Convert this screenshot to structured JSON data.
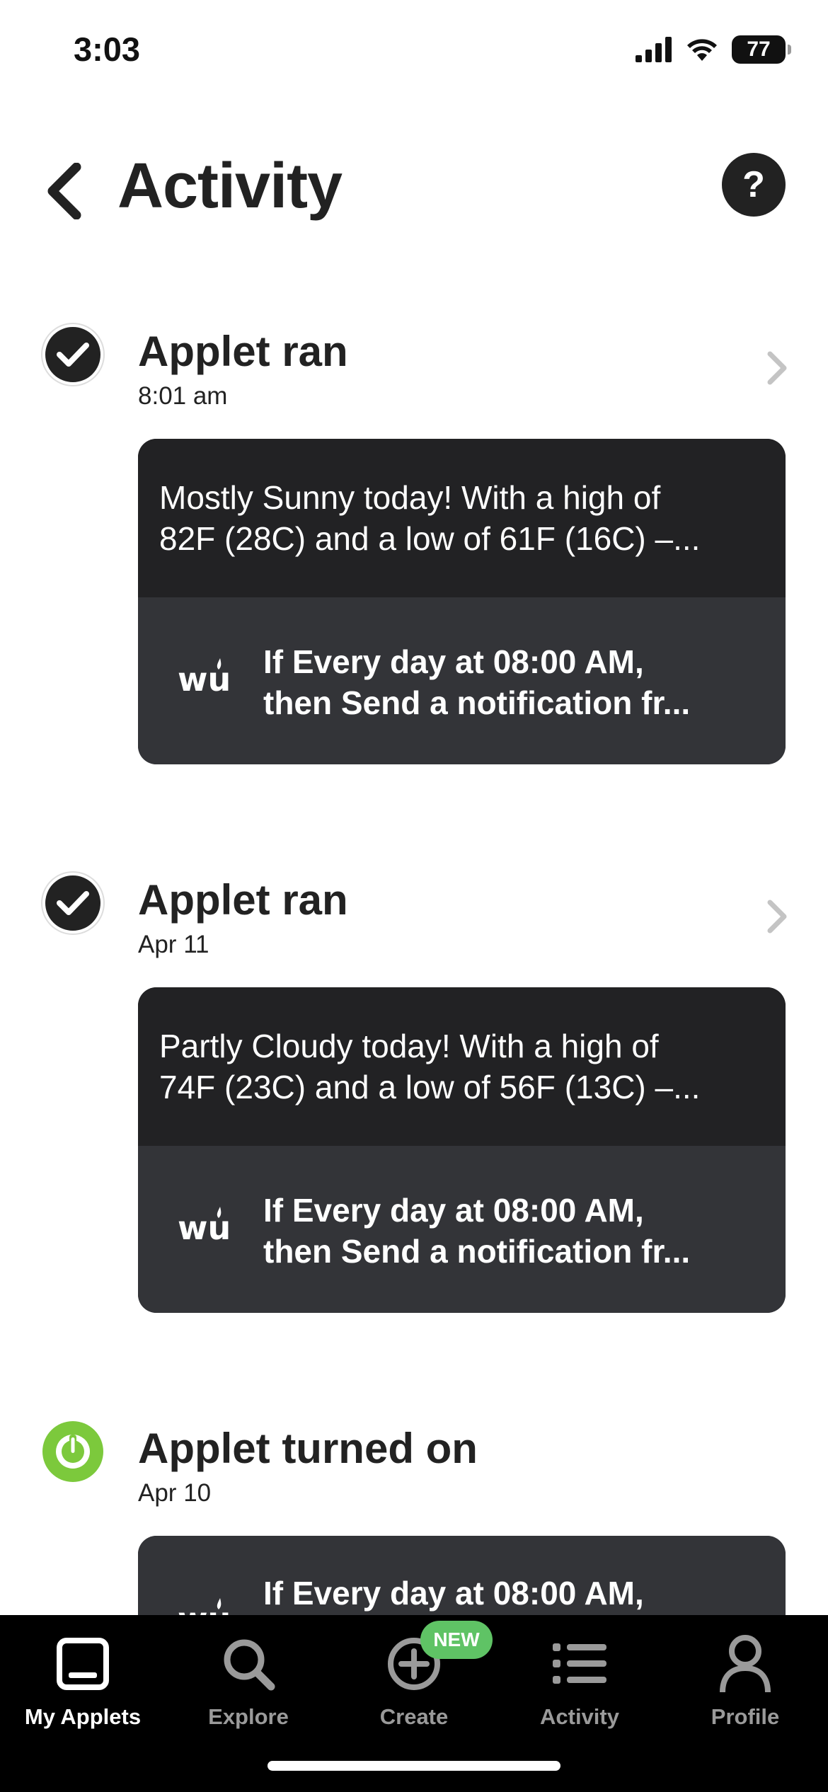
{
  "status_bar": {
    "time": "3:03",
    "battery": "77"
  },
  "header": {
    "title": "Activity",
    "help_label": "?"
  },
  "entries": [
    {
      "title": "Applet ran",
      "time": "8:01 am",
      "icon": "check-circle-icon",
      "message_lines": [
        "Mostly Sunny today! With a high of",
        "82F (28C) and a low of 61F (16C) –..."
      ],
      "applet_lines": [
        "If Every day at 08:00 AM,",
        "then Send a notification fr..."
      ],
      "service": "weather-underground-logo"
    },
    {
      "title": "Applet ran",
      "time": "Apr 11",
      "icon": "check-circle-icon",
      "message_lines": [
        "Partly Cloudy today! With a high of",
        "74F (23C) and a low of 56F (13C) –..."
      ],
      "applet_lines": [
        "If Every day at 08:00 AM,",
        "then Send a notification fr..."
      ],
      "service": "weather-underground-logo"
    },
    {
      "title": "Applet turned on",
      "time": "Apr 10",
      "icon": "power-icon",
      "applet_lines": [
        "If Every day at 08:00 AM,"
      ],
      "service": "weather-underground-logo"
    }
  ],
  "tab_bar": {
    "tabs": [
      {
        "label": "My Applets",
        "icon": "my-applets-icon",
        "active": true
      },
      {
        "label": "Explore",
        "icon": "search-icon",
        "active": false
      },
      {
        "label": "Create",
        "icon": "plus-circle-icon",
        "active": false
      },
      {
        "label": "Activity",
        "icon": "list-icon",
        "active": false
      },
      {
        "label": "Profile",
        "icon": "person-icon",
        "active": false
      }
    ],
    "new_badge": "NEW"
  },
  "colors": {
    "message_bg": "#222224",
    "applet_bg": "#333438",
    "power_green": "#7cc93c",
    "badge_green": "#5fc365"
  }
}
